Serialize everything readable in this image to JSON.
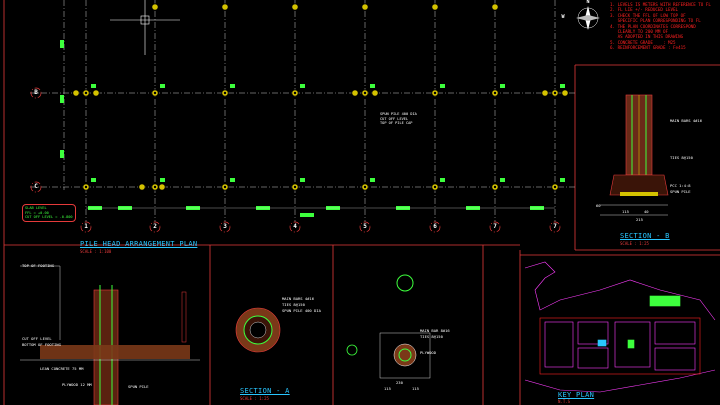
{
  "plan": {
    "title": "PILE HEAD ARRANGEMENT PLAN",
    "scale": "SCALE : 1:100",
    "row_labels": [
      "B",
      "C"
    ],
    "column_labels": [
      "1",
      "2",
      "3",
      "4",
      "5",
      "6",
      "7",
      "7"
    ],
    "callout_left": "SLAB LEVEL\nFFL = +0.00\nCUT OFF LEVEL = -0.800",
    "callout_mid": "SPUN PILE 400 DIA\nCUT OFF LEVEL\nTOP OF PILE CAP"
  },
  "notes": {
    "lines": [
      "1. LEVELS IS METERS WITH REFERENCE TO FL",
      "2. FL LIE +/- REDUCED LEVEL",
      "3. CHECK THE FFL OF LOW TOP OF",
      "   SPECIFIC PLAN CORRESPONDING TO FL",
      "4. THE PLAN COORDINATES CORRESPOND",
      "   CLEARLY TO 200 MM OF",
      "   AS ADOPTED IN THIS DRAWING",
      "5. CONCRETE GRADE    : M25",
      "6. REINFORCEMENT GRADE : Fe415"
    ]
  },
  "compass": {
    "north": "N",
    "west": "W"
  },
  "section_b": {
    "title": "SECTION - B",
    "scale": "SCALE : 1:25",
    "tags": [
      "MAIN BARS 4#16",
      "TIES 8@150",
      "PCC 1:4:8",
      "SPUN PILE",
      "215",
      "60",
      "115",
      "40"
    ]
  },
  "pile_detail": {
    "tags": [
      "TOP OF FOOTING",
      "CUT OFF LEVEL",
      "BOTTOM OF FOOTING",
      "LEAN CONCRETE 75 MM",
      "PLYWOOD 12 MM",
      "SPUN PILE"
    ]
  },
  "section_a": {
    "title": "SECTION - A",
    "scale": "SCALE : 1:25",
    "tags": [
      "MAIN BARS 4#16",
      "TIES 8@150",
      "SPUN PILE 400 DIA"
    ]
  },
  "detail_right": {
    "tags": [
      "MAIN BAR 8#16",
      "TIES 8@150",
      "PLYWOOD",
      "230",
      "115",
      "115"
    ]
  },
  "key_plan": {
    "title": "KEY PLAN",
    "scale": "N.T.S"
  },
  "colors": {
    "background": "#000000",
    "grid_line": "#c8c8c8",
    "frame": "#e53a3a",
    "pile_fill": "#d4c200",
    "dim_green": "#3dff3d",
    "title_cyan": "#29c6ff",
    "keyplan_magenta": "#ff3dff"
  }
}
